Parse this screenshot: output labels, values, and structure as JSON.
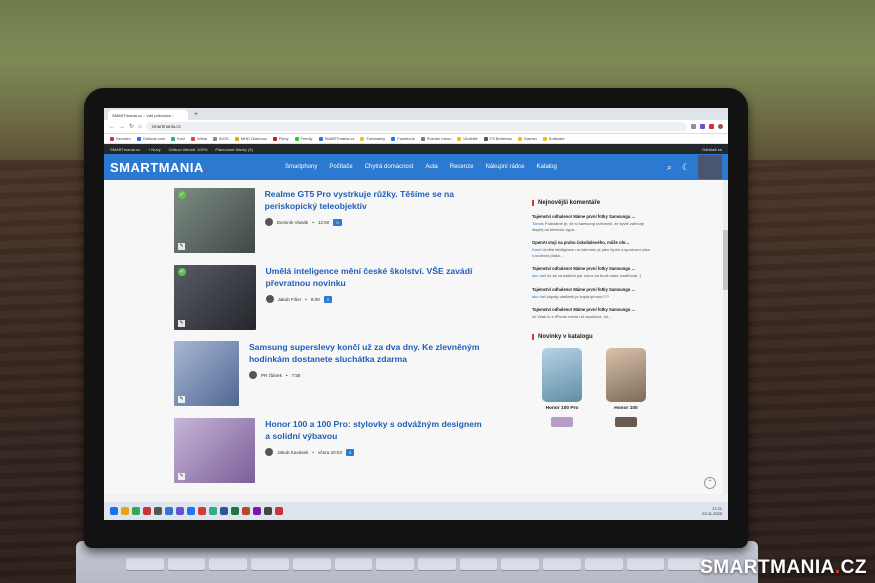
{
  "browser": {
    "tab_label": "SMARTmania.cz – Váš průvodce...",
    "new_tab": "+",
    "url": "smartmania.cz",
    "bookmarks": [
      "Seznam",
      "Outlook.com",
      "Kníž",
      "Wikia",
      "IDOS",
      "MHD Olomouc",
      "Filmy",
      "Feedly",
      "SMARTmania.cz",
      "Fotobanky",
      "Facebook",
      "Polední menu",
      "Úložiště",
      "TS Bohemia",
      "Garmin",
      "Software"
    ]
  },
  "wp_admin": {
    "site": "SMARTmania.cz",
    "new": "+ Nový",
    "stat": "Celkoví čtenáři: 100%",
    "planned": "Plánované články (3)",
    "logout": "Odhlásit se"
  },
  "site": {
    "logo": "SMARTMANIA",
    "logo_dot": ".",
    "nav": [
      "Smartphony",
      "Počítače",
      "Chytrá domácnost",
      "Auta",
      "Recenze",
      "Nákupní rádce",
      "Katalog"
    ]
  },
  "articles": [
    {
      "title": "Realme GT5 Pro vystrkuje růžky. Těšíme se na periskopický teleobjektiv",
      "author": "Dominik Vlasák",
      "time": "12:50",
      "comments": "0",
      "checked": true,
      "thumb_color": "#5d6b63"
    },
    {
      "title": "Umělá inteligence mění české školství. VŠE zavádí převratnou novinku",
      "author": "Jakub Fišer",
      "time": "8:00",
      "comments": "0",
      "checked": true,
      "thumb_color": "#3a3c44"
    },
    {
      "title": "Samsung superslevy končí už za dva dny. Ke zlevněným hodinkám dostanete sluchátka zdarma",
      "author": "PR článek",
      "time": "7:55",
      "comments": "",
      "checked": false,
      "thumb_color": "#7d93b8"
    },
    {
      "title": "Honor 100 a 100 Pro: stylovky s odvážným designem a solidní výbavou",
      "author": "Jakub Kavásek",
      "time": "včera 20:03",
      "comments": "0",
      "checked": false,
      "thumb_color": "#a792c0"
    }
  ],
  "sidebar": {
    "comments_title": "Nejnovější komentáře",
    "comments": [
      {
        "title": "Tajemství odhaleno! Máme první fotky Samsungu ...",
        "user": "Tomáš",
        "text": "Podstatné je, že si samsung uvědomil, že kývlé zahnuty displej na telefonu vypa..."
      },
      {
        "title": "OpenAI stoji na prahu čokoládového, může ohr...",
        "user": "Karel",
        "text": "Umělá inteligence na internetu je jako čípek a sportovní orka s kodexní ptáku..."
      },
      {
        "title": "Tajemství odhaleno! Máme první fotky Samsungu ...",
        "user": "ako dali",
        "text": "no až za dalších par rokov sa bude zase zaobľovať :)"
      },
      {
        "title": "Tajemství odhaleno! Máme první fotky Samsungu ...",
        "user": "ako dali",
        "text": "kopaly obdĺžnik je kopia iphonu???"
      },
      {
        "title": "Tajemství odhaleno! Máme první fotky Samsungu ...",
        "user": "lol",
        "text": "Však to s iPhone mená nič spoločné, lol..."
      }
    ],
    "catalog_title": "Novinky v katalogu",
    "phones": [
      {
        "name": "Honor 100 Pro",
        "color": "#8fb7cf"
      },
      {
        "name": "Honor 100",
        "color": "#c9a98a"
      }
    ]
  },
  "taskbar": {
    "time": "17:21",
    "date": "23.11.2023"
  },
  "watermark": {
    "text": "SMARTMANIA",
    "dot": ".",
    "tld": "CZ"
  }
}
